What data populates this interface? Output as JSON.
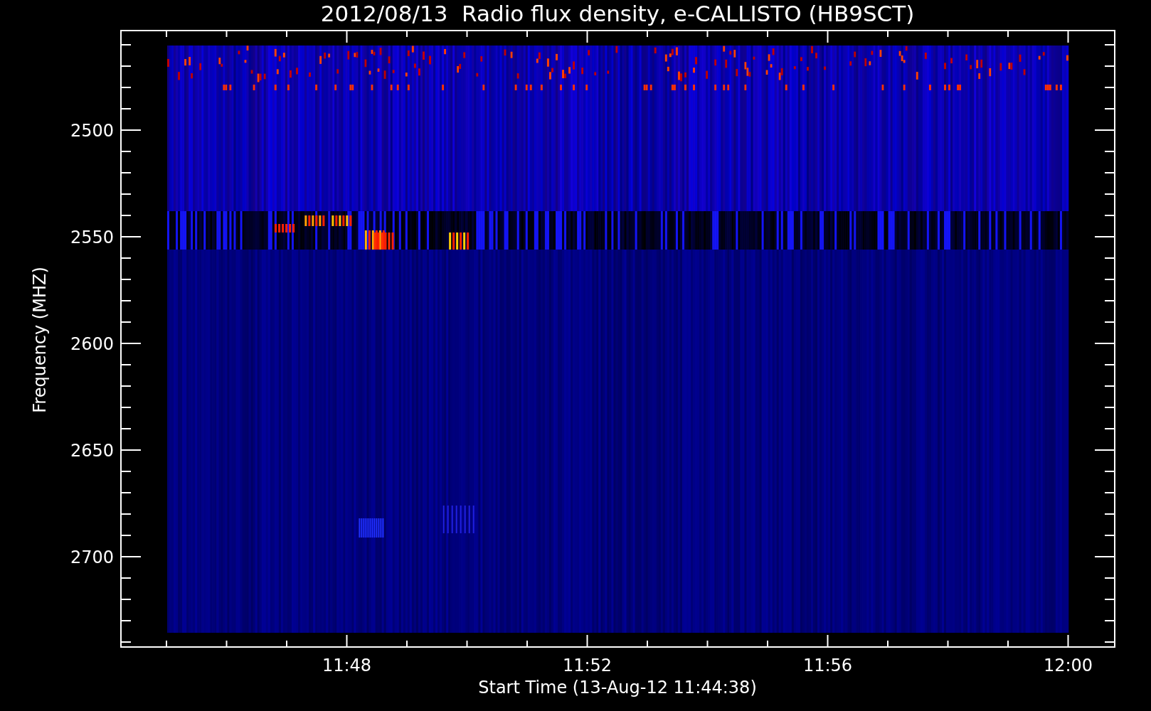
{
  "title": "2012/08/13  Radio flux density, e-CALLISTO (HB9SCT)",
  "y_axis": {
    "label": "Frequency (MHZ)",
    "ticks": [
      "2500",
      "2550",
      "2600",
      "2650",
      "2700"
    ]
  },
  "x_axis": {
    "label": "Start Time (13-Aug-12 11:44:38)",
    "ticks": [
      "11:48",
      "11:52",
      "11:56",
      "12:00"
    ]
  }
}
